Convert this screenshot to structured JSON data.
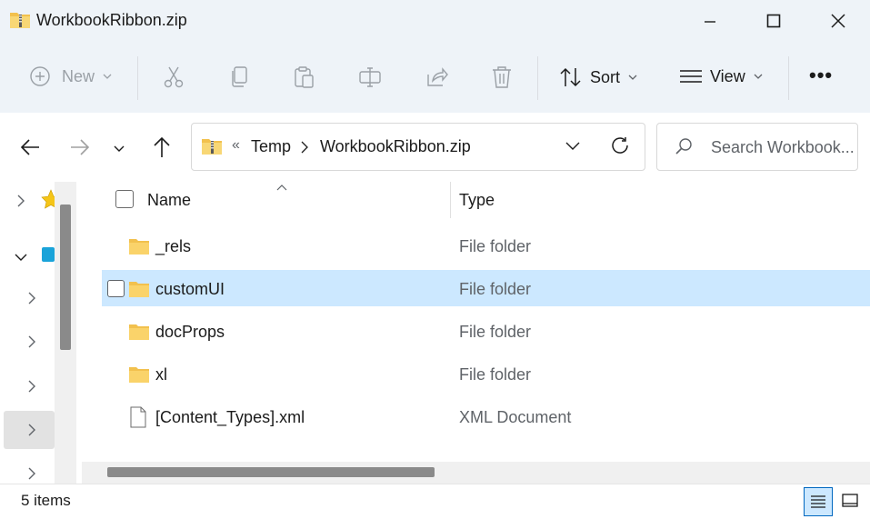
{
  "window": {
    "title": "WorkbookRibbon.zip"
  },
  "toolbar": {
    "new_label": "New",
    "sort_label": "Sort",
    "view_label": "View",
    "more_label": "•••"
  },
  "address": {
    "overflow": "«",
    "crumbs": [
      "Temp",
      "WorkbookRibbon.zip"
    ]
  },
  "search": {
    "placeholder": "Search Workbook..."
  },
  "columns": {
    "name": "Name",
    "type": "Type"
  },
  "files": [
    {
      "name": "_rels",
      "type": "File folder",
      "icon": "folder-icon"
    },
    {
      "name": "customUI",
      "type": "File folder",
      "icon": "folder-icon",
      "selected": true
    },
    {
      "name": "docProps",
      "type": "File folder",
      "icon": "folder-icon"
    },
    {
      "name": "xl",
      "type": "File folder",
      "icon": "folder-icon"
    },
    {
      "name": "[Content_Types].xml",
      "type": "XML Document",
      "icon": "file-icon"
    }
  ],
  "status": {
    "count": "5 items"
  },
  "colors": {
    "accent": "#0067c0",
    "selection": "#cce8ff",
    "folder": "#f8c94a"
  }
}
